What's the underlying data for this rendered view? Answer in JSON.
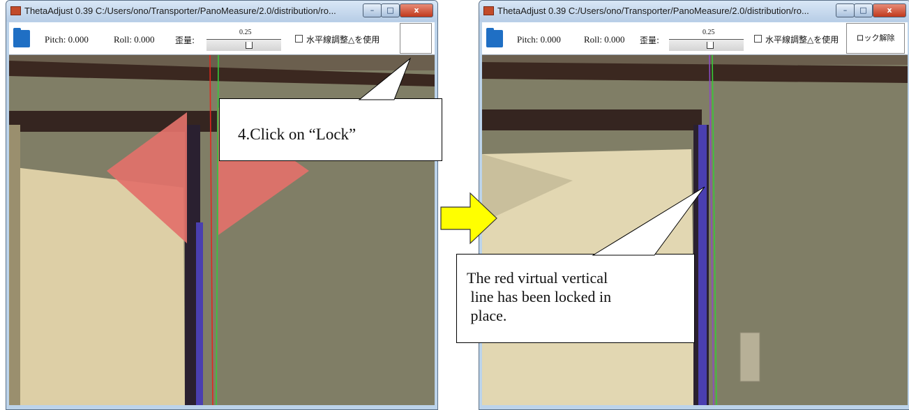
{
  "windows": [
    {
      "title": "ThetaAdjust 0.39  C:/Users/ono/Transporter/PanoMeasure/2.0/distribution/ro...",
      "pitch": "Pitch: 0.000",
      "roll": "Roll: 0.000",
      "distortion_label": "歪量:",
      "slider_value": "0.25",
      "checkbox_label": "水平線調整△を使用",
      "lock_button": ""
    },
    {
      "title": "ThetaAdjust 0.39  C:/Users/ono/Transporter/PanoMeasure/2.0/distribution/ro...",
      "pitch": "Pitch: 0.000",
      "roll": "Roll: 0.000",
      "distortion_label": "歪量:",
      "slider_value": "0.25",
      "checkbox_label": "水平線調整△を使用",
      "lock_button": "ロック解除"
    }
  ],
  "callouts": {
    "lock": "4.Click on “Lock”",
    "locked": "The red virtual vertical\n line has been locked in\n place."
  },
  "colors": {
    "direction_arrows": "#e2716a",
    "red_line": "#e0281e",
    "green_line": "#38c93a",
    "purple_line": "#8a4cc4",
    "next_arrow": "#ffff00"
  }
}
